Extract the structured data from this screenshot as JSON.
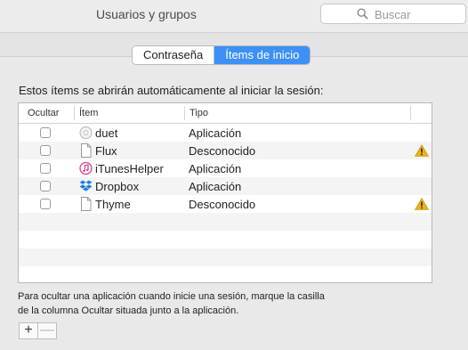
{
  "window": {
    "title": "Usuarios y grupos"
  },
  "search": {
    "placeholder": "Buscar"
  },
  "tabs": [
    {
      "label": "Contraseña",
      "active": false
    },
    {
      "label": "Ítems de inicio",
      "active": true
    }
  ],
  "description": "Estos ítems se abrirán automáticamente al iniciar la sesión:",
  "table": {
    "headers": {
      "hide": "Ocultar",
      "item": "Ítem",
      "type": "Tipo"
    },
    "rows": [
      {
        "name": "duet",
        "type": "Aplicación",
        "icon": "duet-icon",
        "hidden": false,
        "warning": false
      },
      {
        "name": "Flux",
        "type": "Desconocido",
        "icon": "document-icon",
        "hidden": false,
        "warning": true
      },
      {
        "name": "iTunesHelper",
        "type": "Aplicación",
        "icon": "itunes-icon",
        "hidden": false,
        "warning": false
      },
      {
        "name": "Dropbox",
        "type": "Aplicación",
        "icon": "dropbox-icon",
        "hidden": false,
        "warning": false
      },
      {
        "name": "Thyme",
        "type": "Desconocido",
        "icon": "document-icon",
        "hidden": false,
        "warning": true
      }
    ]
  },
  "footer_note": {
    "line1": "Para ocultar una aplicación cuando inicie una sesión, marque la casilla",
    "line2": "de la columna Ocultar situada junto a la aplicación."
  },
  "buttons": {
    "add": "+",
    "remove": "—"
  },
  "colors": {
    "accent": "#3d91f6",
    "warning": "#e8b21b",
    "dropbox": "#1f7ce0"
  }
}
